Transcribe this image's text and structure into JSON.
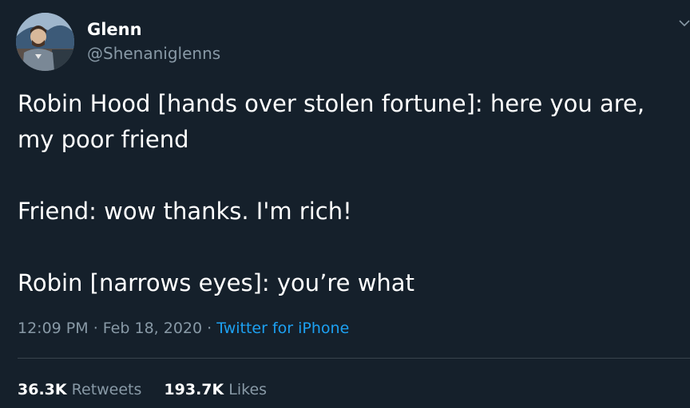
{
  "author": {
    "name": "Glenn",
    "handle": "@Shenaniglenns"
  },
  "tweet": {
    "lines": [
      "Robin Hood [hands over stolen fortune]: here you are,",
      "my poor friend",
      "Friend: wow thanks. I'm rich!",
      "Robin [narrows eyes]: you’re what"
    ]
  },
  "meta": {
    "time": "12:09 PM",
    "separator": "·",
    "date": "Feb 18, 2020",
    "source": "Twitter for iPhone"
  },
  "stats": {
    "retweets_count": "36.3K",
    "retweets_label": "Retweets",
    "likes_count": "193.7K",
    "likes_label": "Likes"
  },
  "icons": {
    "caret": "chevron-down-icon",
    "avatar": "avatar"
  },
  "colors": {
    "background": "#15202b",
    "text": "#ffffff",
    "muted": "#8899a6",
    "link": "#1da1f2",
    "divider": "#38444d"
  }
}
